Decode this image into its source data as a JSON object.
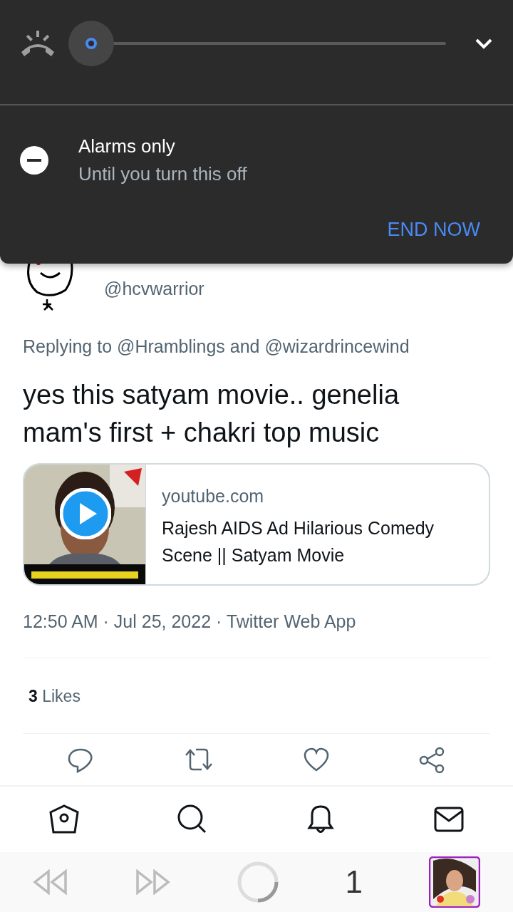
{
  "volume_panel": {
    "mode": {
      "title": "Alarms only",
      "subtitle": "Until you turn this off"
    },
    "end_button": "END NOW"
  },
  "tweet": {
    "handle": "@hcvwarrior",
    "replying_prefix": "Replying to",
    "replying_to": "@Hramblings and @wizardrincewind",
    "text": "yes this satyam movie.. genelia mam's first + chakri top music",
    "card": {
      "domain": "youtube.com",
      "title": "Rajesh AIDS Ad Hilarious Comedy Scene || Satyam Movie"
    },
    "meta": "12:50 AM · Jul 25, 2022 · Twitter Web App",
    "likes_count": "3",
    "likes_label": "Likes"
  },
  "browser_bar": {
    "tab_count": "1"
  }
}
